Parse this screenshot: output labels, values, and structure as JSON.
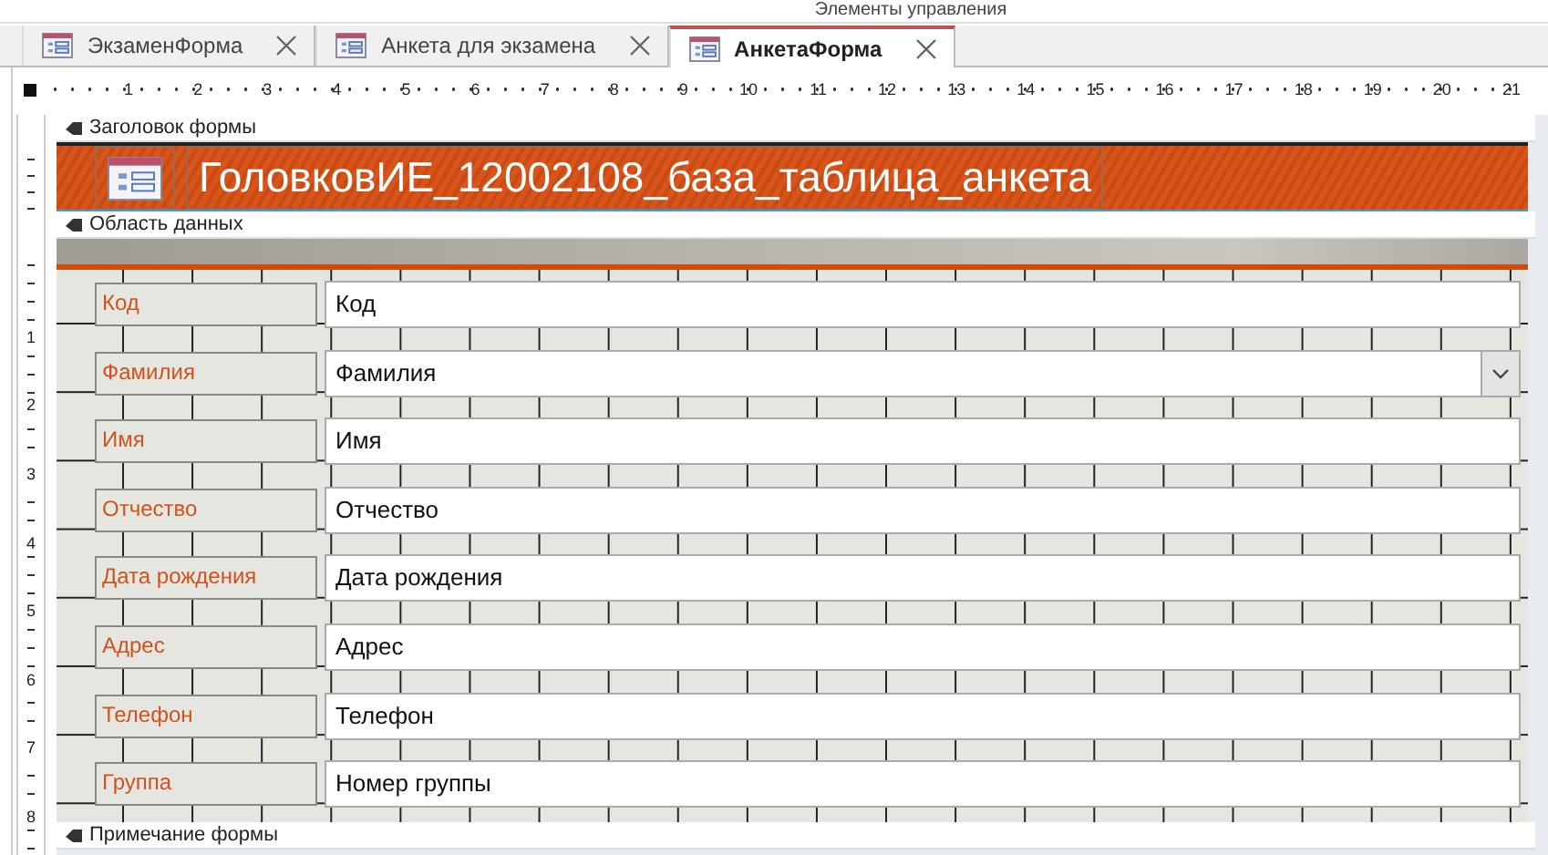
{
  "ribbon_group": {
    "title": "Элементы управления"
  },
  "tabs": [
    {
      "label": "ЭкзаменФорма",
      "selected": false
    },
    {
      "label": "Анкета для экзамена",
      "selected": false
    },
    {
      "label": "АнкетаФорма",
      "selected": true
    }
  ],
  "ruler": {
    "marks": [
      "1",
      "2",
      "3",
      "4",
      "5",
      "6",
      "7",
      "8",
      "9",
      "10",
      "11",
      "12",
      "13",
      "14",
      "15",
      "16",
      "17",
      "18",
      "19",
      "20",
      "21"
    ]
  },
  "vertical_ruler": {
    "marks": [
      "1",
      "2",
      "3",
      "4",
      "5",
      "6",
      "7",
      "8"
    ]
  },
  "form_header": {
    "section_label": "Заголовок формы",
    "title": "ГоловковИЕ_12002108_база_таблица_анкета"
  },
  "detail": {
    "section_label": "Область данных",
    "fields": [
      {
        "label": "Код",
        "control": "Код",
        "kind": "textbox"
      },
      {
        "label": "Фамилия",
        "control": "Фамилия",
        "kind": "combobox"
      },
      {
        "label": "Имя",
        "control": "Имя",
        "kind": "textbox"
      },
      {
        "label": "Отчество",
        "control": "Отчество",
        "kind": "textbox"
      },
      {
        "label": "Дата рождения",
        "control": "Дата рождения",
        "kind": "textbox"
      },
      {
        "label": "Адрес",
        "control": "Адрес",
        "kind": "textbox"
      },
      {
        "label": "Телефон",
        "control": "Телефон",
        "kind": "textbox"
      },
      {
        "label": "Группа",
        "control": "Номер группы",
        "kind": "textbox"
      }
    ]
  },
  "form_footer": {
    "section_label": "Примечание формы"
  }
}
